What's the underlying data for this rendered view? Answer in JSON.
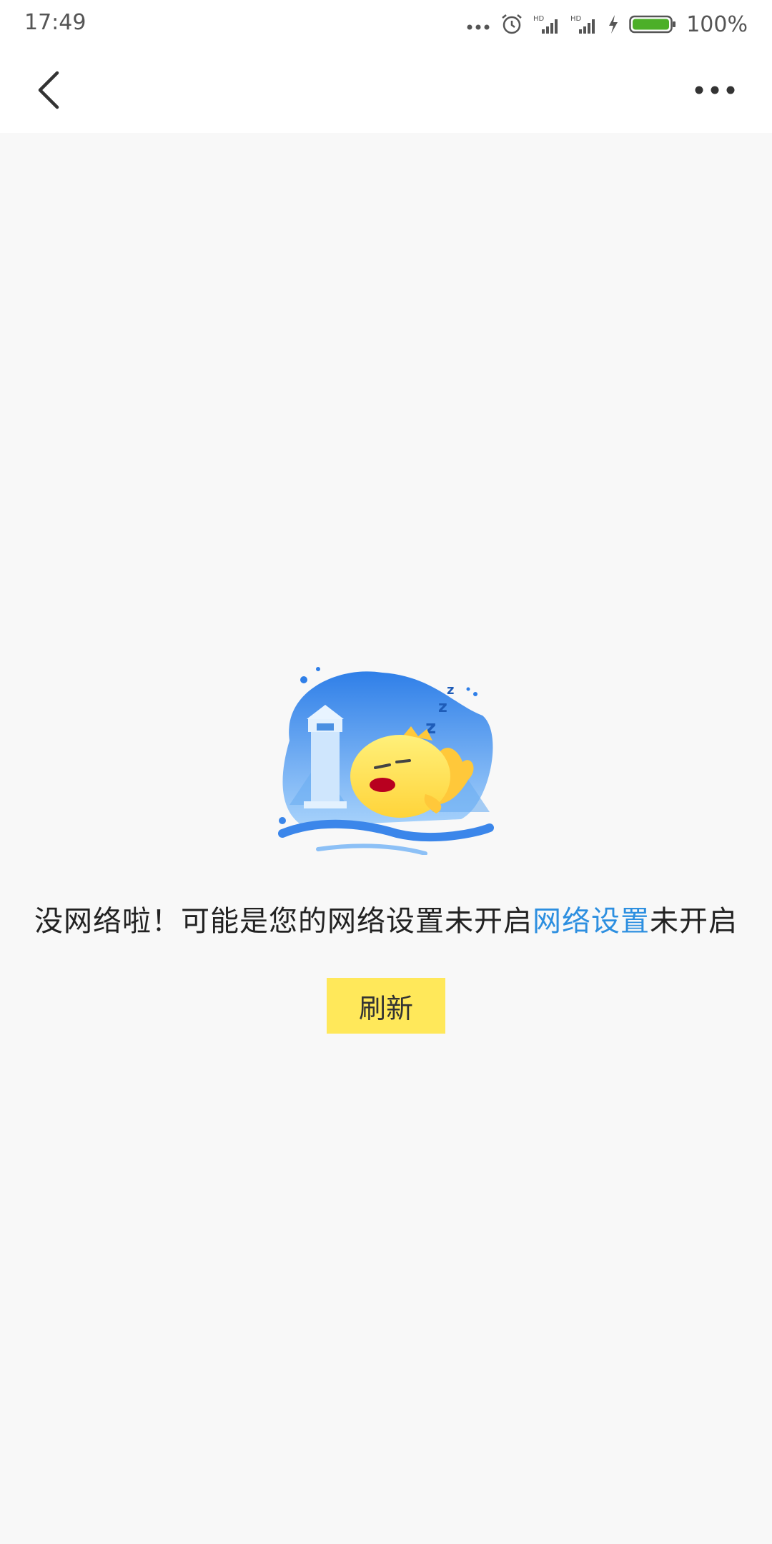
{
  "status_bar": {
    "time": "17:49",
    "battery": "100%",
    "icons": [
      "more-dots-icon",
      "alarm-icon",
      "hd-signal-icon",
      "hd-signal-icon",
      "charging-icon",
      "battery-icon"
    ],
    "battery_color": "#4caf28"
  },
  "nav": {
    "back_icon": "chevron-left-icon",
    "more_icon": "more-horizontal-icon"
  },
  "empty_state": {
    "illustration": "sleeping-fish-lighthouse-illustration",
    "message_prefix": "没网络啦！可能是您的网络设置未开启",
    "message_link": "网络设置",
    "message_suffix": "未开启",
    "refresh_label": "刷新"
  },
  "colors": {
    "link": "#2d8fe0",
    "button": "#ffe85a",
    "background": "#f8f8f8"
  }
}
